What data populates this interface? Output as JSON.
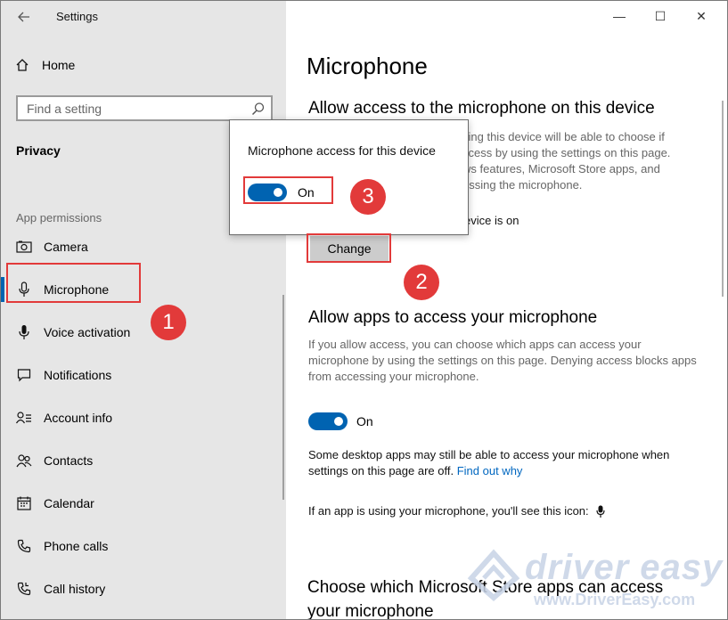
{
  "window": {
    "title": "Settings",
    "controls": {
      "minimize": "—",
      "maximize": "☐",
      "close": "✕"
    }
  },
  "sidebar": {
    "home_label": "Home",
    "search_placeholder": "Find a setting",
    "section_title": "Privacy",
    "group_label": "App permissions",
    "items": [
      {
        "label": "Camera",
        "icon": "camera-icon"
      },
      {
        "label": "Microphone",
        "icon": "microphone-icon",
        "active": true
      },
      {
        "label": "Voice activation",
        "icon": "voice-activation-icon"
      },
      {
        "label": "Notifications",
        "icon": "notifications-icon"
      },
      {
        "label": "Account info",
        "icon": "account-info-icon"
      },
      {
        "label": "Contacts",
        "icon": "contacts-icon"
      },
      {
        "label": "Calendar",
        "icon": "calendar-icon"
      },
      {
        "label": "Phone calls",
        "icon": "phone-icon"
      },
      {
        "label": "Call history",
        "icon": "call-history-icon"
      }
    ]
  },
  "main": {
    "page_title": "Microphone",
    "section1": {
      "heading": "Allow access to the microphone on this device",
      "desc_line1": "sing this device will be able to choose if",
      "desc_line2": "ccess by using the settings on this page.",
      "desc_line3": "ws features, Microsoft Store apps, and",
      "desc_line4": "essing the microphone.",
      "status": "evice is on",
      "change_label": "Change"
    },
    "section2": {
      "heading": "Allow apps to access your microphone",
      "desc": "If you allow access, you can choose which apps can access your microphone by using the settings on this page. Denying access blocks apps from accessing your microphone.",
      "toggle_label": "On",
      "note_text": "Some desktop apps may still be able to access your microphone when settings on this page are off.",
      "note_link": "Find out why",
      "icon_note": "If an app is using your microphone, you'll see this icon:"
    },
    "section3": {
      "heading_line1": "Choose which Microsoft Store apps can access",
      "heading_line2": "your microphone"
    }
  },
  "popup": {
    "title": "Microphone access for this device",
    "toggle_label": "On"
  },
  "annotations": {
    "marker1": "1",
    "marker2": "2",
    "marker3": "3",
    "color": "#e23a3a"
  },
  "watermark": {
    "brand": "driver easy",
    "url": "www.DriverEasy.com"
  },
  "colors": {
    "accent": "#0063b1",
    "sidebar_bg": "#e6e6e6",
    "link": "#0067c0"
  }
}
